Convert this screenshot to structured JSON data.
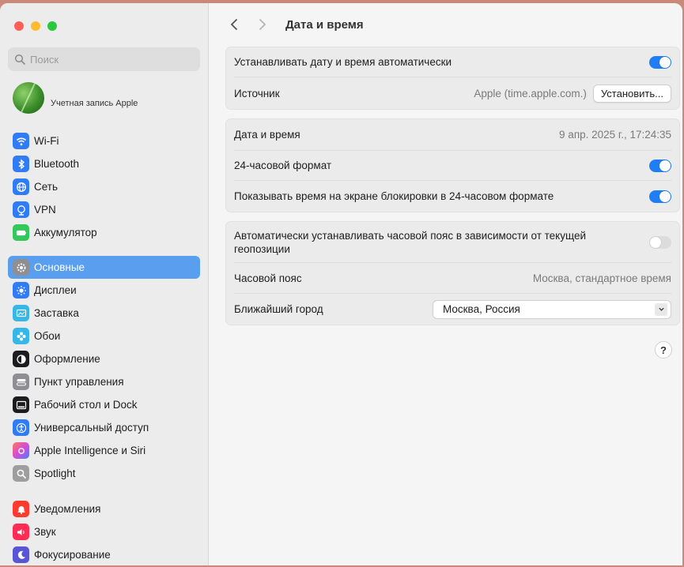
{
  "window": {
    "title": "Дата и время"
  },
  "sidebar": {
    "search_placeholder": "Поиск",
    "account_label": "Учетная запись Apple",
    "groups": [
      [
        {
          "label": "Wi-Fi",
          "icon": "wifi-icon"
        },
        {
          "label": "Bluetooth",
          "icon": "bluetooth-icon"
        },
        {
          "label": "Сеть",
          "icon": "globe-icon"
        },
        {
          "label": "VPN",
          "icon": "vpn-icon"
        },
        {
          "label": "Аккумулятор",
          "icon": "battery-icon"
        }
      ],
      [
        {
          "label": "Основные",
          "icon": "gear-icon",
          "active": true
        },
        {
          "label": "Дисплеи",
          "icon": "sun-icon"
        },
        {
          "label": "Заставка",
          "icon": "screensaver-icon"
        },
        {
          "label": "Обои",
          "icon": "flower-icon"
        },
        {
          "label": "Оформление",
          "icon": "appearance-icon"
        },
        {
          "label": "Пункт управления",
          "icon": "control-center-icon"
        },
        {
          "label": "Рабочий стол и Dock",
          "icon": "dock-icon"
        },
        {
          "label": "Универсальный доступ",
          "icon": "accessibility-icon"
        },
        {
          "label": "Apple Intelligence и Siri",
          "icon": "siri-icon"
        },
        {
          "label": "Spotlight",
          "icon": "magnifier-icon"
        }
      ],
      [
        {
          "label": "Уведомления",
          "icon": "bell-icon"
        },
        {
          "label": "Звук",
          "icon": "speaker-icon"
        },
        {
          "label": "Фокусирование",
          "icon": "moon-icon"
        }
      ]
    ]
  },
  "main": {
    "title": "Дата и время",
    "auto_set_label": "Устанавливать дату и время автоматически",
    "auto_set_on": true,
    "source_label": "Источник",
    "source_value": "Apple (time.apple.com.)",
    "set_button": "Установить...",
    "datetime_label": "Дата и время",
    "datetime_value": "9 апр. 2025 г., 17:24:35",
    "format24_label": "24-часовой формат",
    "format24_on": true,
    "lockscreen24_label": "Показывать время на экране блокировки в 24-часовом формате",
    "lockscreen24_on": true,
    "auto_tz_label": "Автоматически устанавливать часовой пояс в зависимости от текущей геопозиции",
    "auto_tz_on": false,
    "timezone_label": "Часовой пояс",
    "timezone_value": "Москва, стандартное время",
    "city_label": "Ближайший город",
    "city_value": "Москва, Россия",
    "help": "?"
  },
  "colors": {
    "accent": "#1f7ef5",
    "active_item": "#5a9ef0"
  }
}
